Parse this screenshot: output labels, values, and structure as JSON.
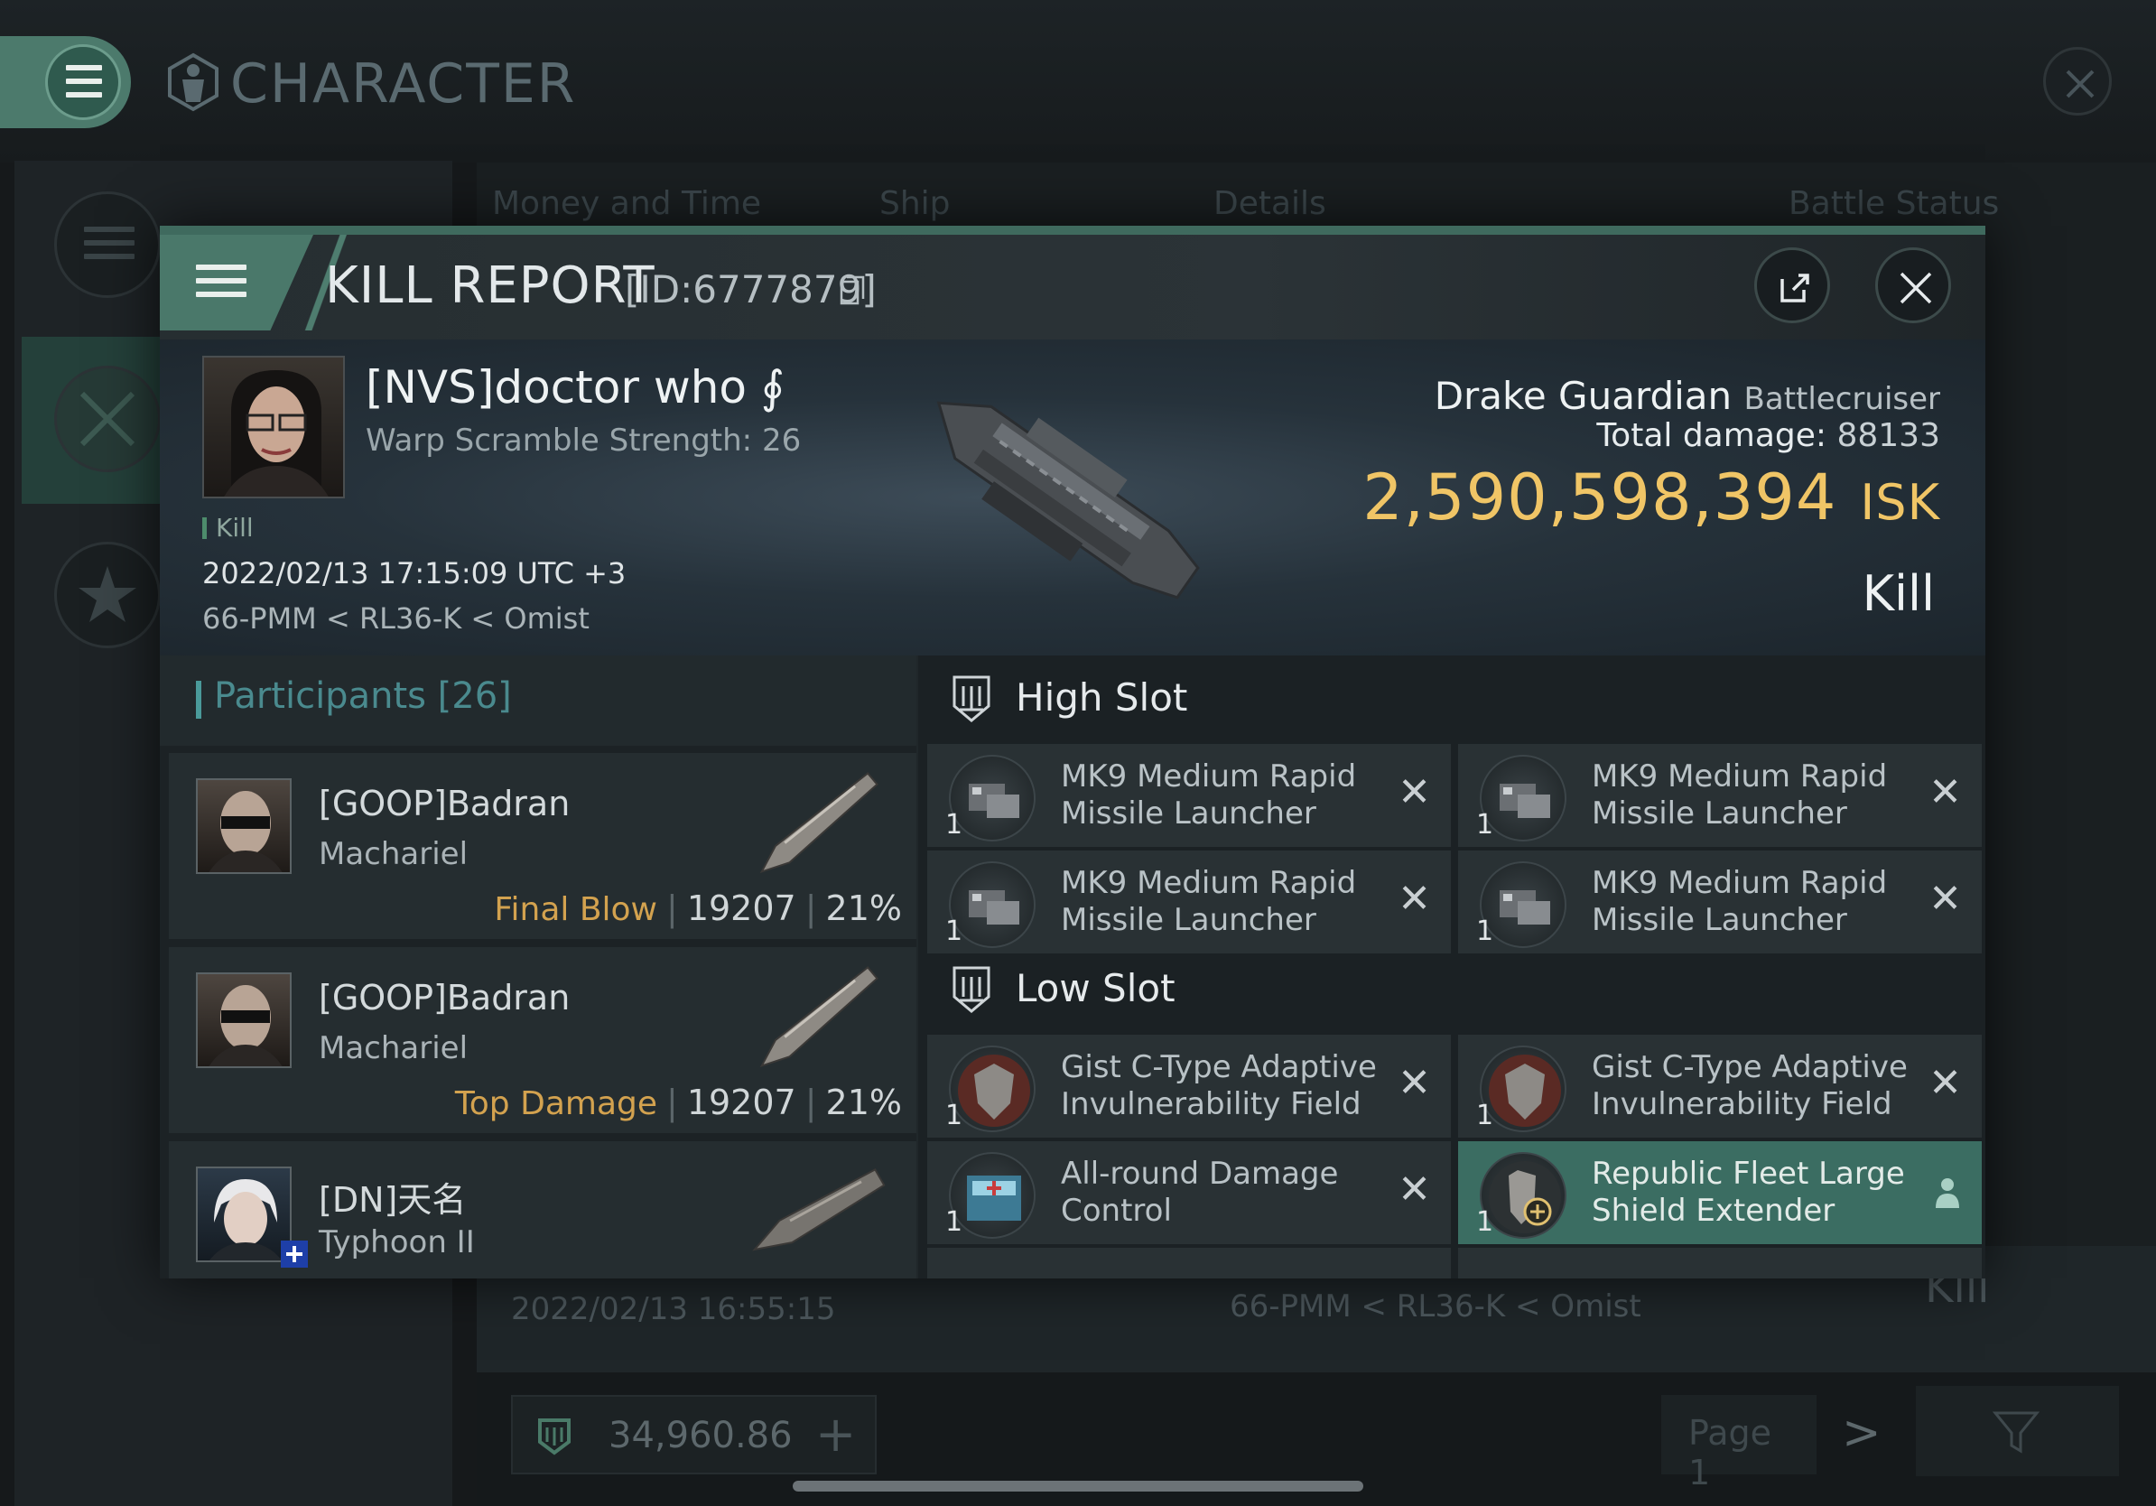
{
  "background": {
    "title": "CHARACTER",
    "tabs": [
      "Money and Time",
      "Ship",
      "Details",
      "Battle Status"
    ],
    "row": {
      "date": "2022/02/13  16:55:15",
      "location": "66-PMM < RL36-K < Omist",
      "status": "Kill"
    },
    "wallet": "34,960.86",
    "page": "Page 1"
  },
  "modal": {
    "title": "KILL REPORT",
    "id": "[ID:6777879]"
  },
  "victim": {
    "pilot": "[NVS]doctor who ∮",
    "warp_scramble": "Warp Scramble Strength: 26",
    "tag": "Kill",
    "datetime": "2022/02/13 17:15:09 UTC +3",
    "location": "66-PMM < RL36-K < Omist",
    "ship": "Drake Guardian",
    "ship_class": "Battlecruiser",
    "total_damage_label": "Total damage:",
    "total_damage": "88133",
    "isk_value": "2,590,598,394",
    "isk_unit": "ISK",
    "result": "Kill"
  },
  "participants": {
    "title": "Participants [26]",
    "rows": [
      {
        "name": "[GOOP]Badran",
        "ship": "Machariel",
        "label": "Final Blow",
        "damage": "19207",
        "percent": "21%"
      },
      {
        "name": "[GOOP]Badran",
        "ship": "Machariel",
        "label": "Top Damage",
        "damage": "19207",
        "percent": "21%"
      },
      {
        "name": "[DN]天名",
        "ship": "Typhoon II"
      }
    ]
  },
  "fitting": {
    "high_slot": {
      "title": "High Slot",
      "modules": [
        {
          "qty": "1",
          "name": "MK9 Medium Rapid Missile Launcher"
        },
        {
          "qty": "1",
          "name": "MK9 Medium Rapid Missile Launcher"
        },
        {
          "qty": "1",
          "name": "MK9 Medium Rapid Missile Launcher"
        },
        {
          "qty": "1",
          "name": "MK9 Medium Rapid Missile Launcher"
        }
      ]
    },
    "low_slot": {
      "title": "Low Slot",
      "modules": [
        {
          "qty": "1",
          "name": "Gist C-Type Adaptive Invulnerability Field"
        },
        {
          "qty": "1",
          "name": "Gist C-Type Adaptive Invulnerability Field"
        },
        {
          "qty": "1",
          "name": "All-round Damage Control"
        },
        {
          "qty": "1",
          "name": "Republic Fleet Large Shield Extender"
        }
      ]
    }
  },
  "colors": {
    "accent": "#4a786a",
    "isk": "#f0c566",
    "final_blow": "#d3a24f",
    "highlight": "#3b6d62"
  }
}
